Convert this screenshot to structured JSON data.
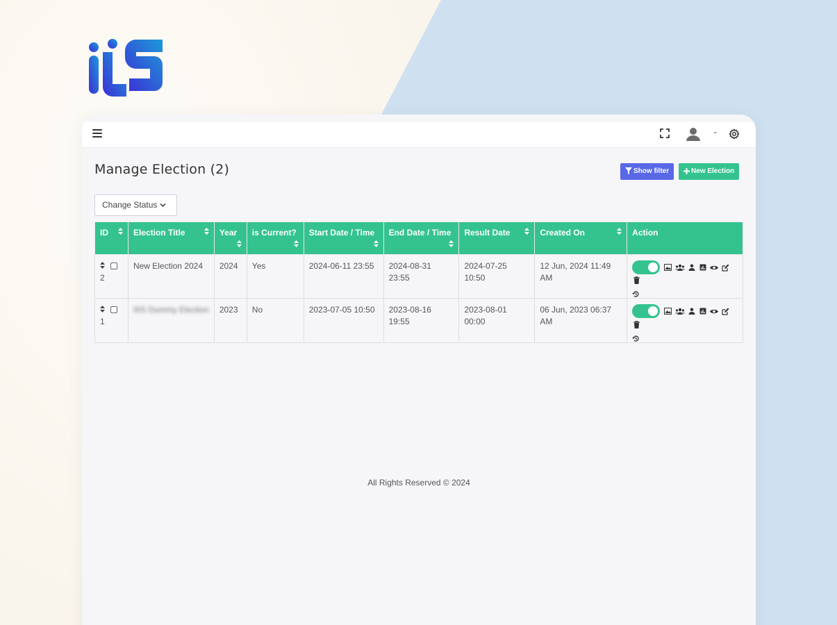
{
  "brand": {
    "logo_text": "iiS"
  },
  "topbar": {
    "menu_icon": "hamburger-icon",
    "fullscreen_icon": "fullscreen-icon",
    "avatar_icon": "user-avatar-icon",
    "dropdown_icon": "chevron-down-icon",
    "settings_icon": "gear-icon"
  },
  "page": {
    "title": "Manage Election (2)",
    "filter_button": "Show filter",
    "new_button": "New Election",
    "status_dropdown": "Change Status"
  },
  "table": {
    "columns": [
      "ID",
      "Election Title",
      "Year",
      "is Current?",
      "Start Date / Time",
      "End Date / Time",
      "Result Date",
      "Created On",
      "Action"
    ],
    "rows": [
      {
        "id": "2",
        "title": "New Election 2024",
        "year": "2024",
        "current": "Yes",
        "start": "2024-06-11 23:55",
        "end": "2024-08-31 23:55",
        "result": "2024-07-25 10:50",
        "created": "12 Jun, 2024 11:49 AM",
        "active": true
      },
      {
        "id": "1",
        "title": "IIIS Dummy Election",
        "year": "2023",
        "current": "No",
        "start": "2023-07-05 10:50",
        "end": "2023-08-16 19:55",
        "result": "2023-08-01 00:00",
        "created": "06 Jun, 2023 06:37 AM",
        "active": true
      }
    ],
    "action_icons": [
      "image-icon",
      "users-icon",
      "candidate-icon",
      "report-icon",
      "view-icon",
      "edit-icon",
      "delete-icon",
      "history-icon"
    ]
  },
  "footer": {
    "text": "All Rights Reserved © 2024"
  },
  "colors": {
    "primary_green": "#34c38f",
    "primary_blue": "#5868e6",
    "logo_blue": "#2f3fd8",
    "logo_teal": "#1f8ad6"
  }
}
